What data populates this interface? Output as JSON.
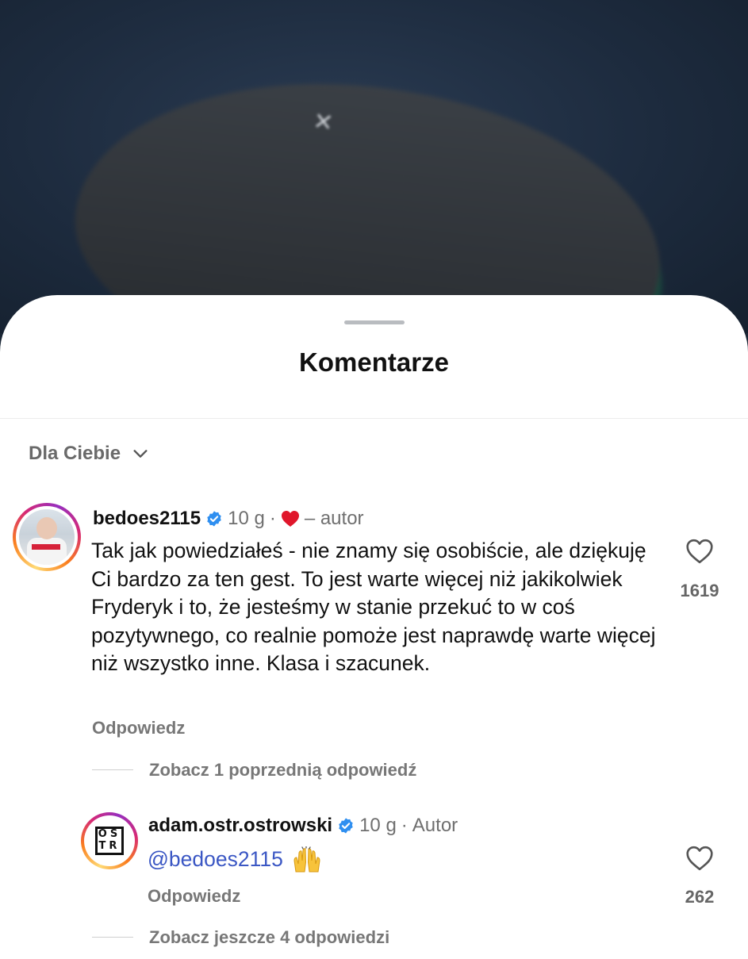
{
  "sheet": {
    "title": "Komentarze"
  },
  "sort": {
    "label": "Dla Ciebie"
  },
  "comments": [
    {
      "username": "bedoes2115",
      "time": "10 g",
      "separator": "·",
      "tag": "– autor",
      "text": "Tak jak powiedziałeś - nie znamy się osobiście, ale dziękuję Ci bardzo za ten gest. To jest warte więcej niż jakikolwiek Fryderyk i to, że jesteśmy w stanie przekuć to w coś pozytywnego, co realnie pomoże jest naprawdę warte więcej niż wszystko inne. Klasa i szacunek.",
      "reply_label": "Odpowiedz",
      "like_count": "1619",
      "view_replies": "Zobacz 1 poprzednią odpowiedź"
    },
    {
      "username": "adam.ostr.ostrowski",
      "time": "10 g",
      "separator": "·",
      "tag": "Autor",
      "mention": "@bedoes2115",
      "reply_label": "Odpowiedz",
      "like_count": "262",
      "view_replies": "Zobacz jeszcze 4 odpowiedzi"
    }
  ],
  "avatar_logo": [
    "OS",
    "TR"
  ],
  "colors": {
    "verified": "#2f8ff0",
    "mention": "#3b57c4",
    "heart_red": "#e0162b"
  },
  "icons": {
    "verified": "verified-badge-icon",
    "like": "heart-outline-icon",
    "creator_like": "heart-filled-icon",
    "sort": "chevron-down-icon",
    "emoji": "raising-hands-emoji"
  }
}
